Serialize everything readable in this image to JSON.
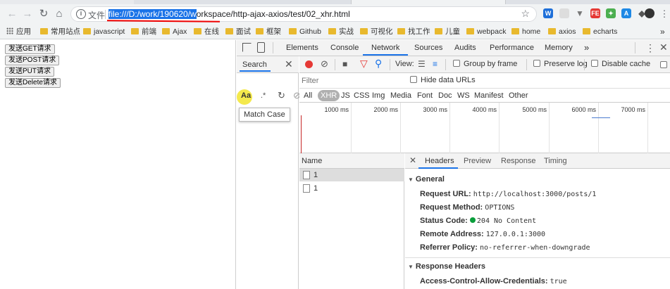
{
  "browser": {
    "nav": {
      "back_icon": "back-arrow-icon",
      "forward_icon": "forward-arrow-icon",
      "reload_icon": "reload-icon",
      "home_icon": "home-icon"
    },
    "omnibox": {
      "scheme_label": "文件",
      "url_selected": "file:///D:/work/190620/w",
      "url_rest": "orkspace/http-ajax-axios/test/02_xhr.html"
    },
    "bookmarks": [
      {
        "label": "应用"
      },
      {
        "label": "常用站点"
      },
      {
        "label": "javascript"
      },
      {
        "label": "前端"
      },
      {
        "label": "Ajax"
      },
      {
        "label": "在线"
      },
      {
        "label": "面试"
      },
      {
        "label": "框架"
      },
      {
        "label": "Github"
      },
      {
        "label": "实战"
      },
      {
        "label": "可视化"
      },
      {
        "label": "找工作"
      },
      {
        "label": "儿童"
      },
      {
        "label": "webpack"
      },
      {
        "label": "home"
      },
      {
        "label": "axios"
      },
      {
        "label": "echarts"
      }
    ],
    "bookmarks_more": "»"
  },
  "page": {
    "buttons": [
      {
        "label": "发送GET请求"
      },
      {
        "label": "发送POST请求"
      },
      {
        "label": "发送PUT请求"
      },
      {
        "label": "发送Delete请求"
      }
    ]
  },
  "devtools": {
    "tabs": [
      "Elements",
      "Console",
      "Network",
      "Sources",
      "Audits",
      "Performance",
      "Memory"
    ],
    "tabs_more": "»",
    "active_tab": "Network",
    "search": {
      "title": "Search",
      "close": "✕",
      "match_case_tip": "Match Case",
      "regex": ".*"
    },
    "controls": {
      "view_label": "View:",
      "group_by_frame": "Group by frame",
      "preserve_log": "Preserve log",
      "disable_cache": "Disable cache"
    },
    "filter": {
      "placeholder": "Filter",
      "hide_data_urls": "Hide data URLs"
    },
    "types": [
      "All",
      "XHR",
      "JS",
      "CSS",
      "Img",
      "Media",
      "Font",
      "Doc",
      "WS",
      "Manifest",
      "Other"
    ],
    "active_type": "XHR",
    "timeline_ticks": [
      "1000 ms",
      "2000 ms",
      "3000 ms",
      "4000 ms",
      "5000 ms",
      "6000 ms",
      "7000 ms"
    ],
    "name_header": "Name",
    "requests": [
      {
        "name": "1"
      },
      {
        "name": "1"
      }
    ],
    "detail_tabs": [
      "Headers",
      "Preview",
      "Response",
      "Timing"
    ],
    "detail_close": "✕",
    "general": {
      "title": "General",
      "rows": [
        {
          "key": "Request URL:",
          "value": "http://localhost:3000/posts/1"
        },
        {
          "key": "Request Method:",
          "value": "OPTIONS"
        },
        {
          "key": "Status Code:",
          "value": "204 No Content"
        },
        {
          "key": "Remote Address:",
          "value": "127.0.0.1:3000"
        },
        {
          "key": "Referrer Policy:",
          "value": "no-referrer-when-downgrade"
        }
      ]
    },
    "response_headers": {
      "title": "Response Headers",
      "rows": [
        {
          "key": "Access-Control-Allow-Credentials:",
          "value": "true"
        }
      ]
    }
  },
  "colors": {
    "accent": "#1a73e8",
    "record": "#e53935",
    "status_ok": "#0a9e3b",
    "highlight": "#f4e94c"
  }
}
